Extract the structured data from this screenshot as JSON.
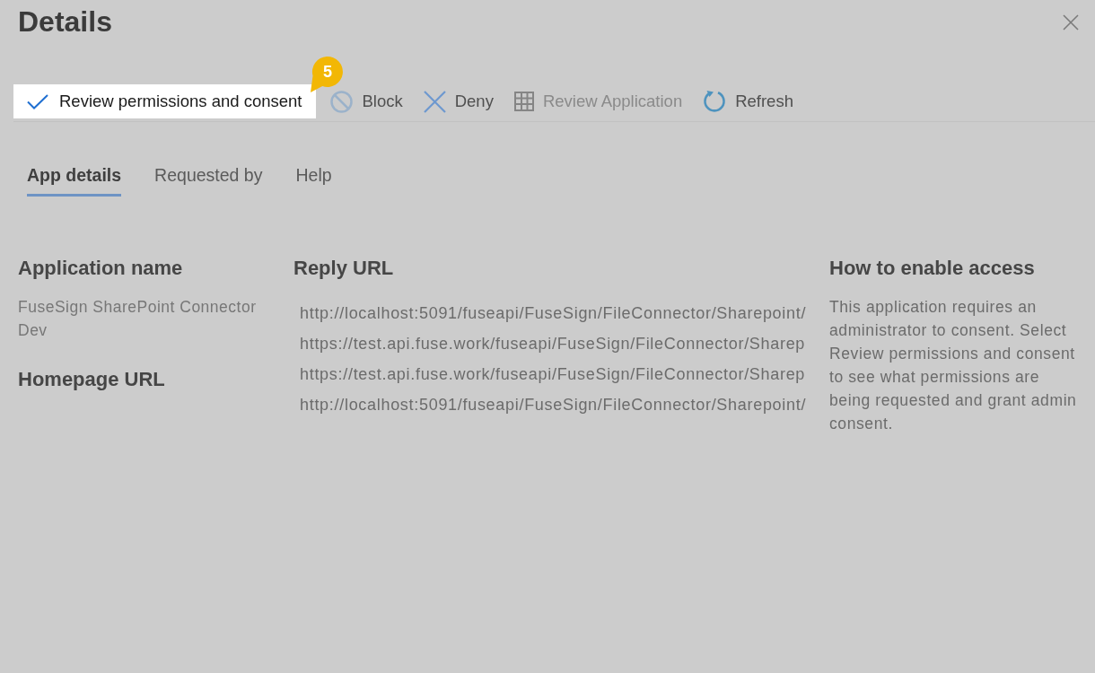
{
  "panel": {
    "title": "Details"
  },
  "toolbar": [
    {
      "label": "Review permissions and consent",
      "highlighted": true,
      "disabled": false
    },
    {
      "label": "Block",
      "highlighted": false,
      "disabled": false
    },
    {
      "label": "Deny",
      "highlighted": false,
      "disabled": false
    },
    {
      "label": "Review Application",
      "highlighted": false,
      "disabled": true
    },
    {
      "label": "Refresh",
      "highlighted": false,
      "disabled": false
    }
  ],
  "step_badge": {
    "label": "5"
  },
  "tabs": [
    {
      "label": "App details",
      "selected": true
    },
    {
      "label": "Requested by",
      "selected": false
    },
    {
      "label": "Help",
      "selected": false
    }
  ],
  "details": {
    "application_name": {
      "heading": "Application name",
      "value": "FuseSign SharePoint Connector Dev"
    },
    "homepage_url": {
      "heading": "Homepage URL"
    },
    "reply_url": {
      "heading": "Reply URL",
      "urls": [
        "http://localhost:5091/fuseapi/FuseSign/FileConnector/Sharepoint/",
        "https://test.api.fuse.work/fuseapi/FuseSign/FileConnector/Sharep",
        "https://test.api.fuse.work/fuseapi/FuseSign/FileConnector/Sharep",
        "http://localhost:5091/fuseapi/FuseSign/FileConnector/Sharepoint/"
      ]
    },
    "how_to_enable_access": {
      "heading": "How to enable access",
      "text": "This application requires an administrator to consent. Select Review permissions and consent to see what permissions are being requested and grant admin consent."
    }
  }
}
